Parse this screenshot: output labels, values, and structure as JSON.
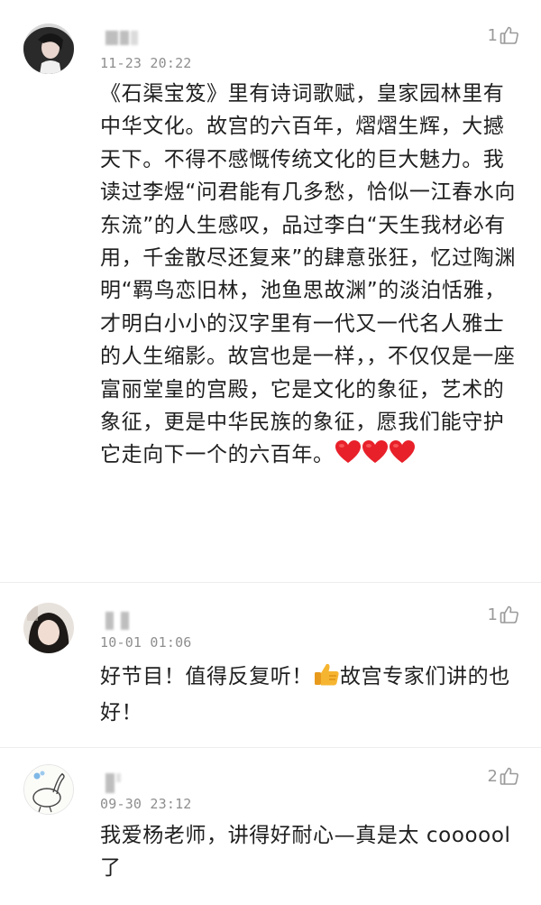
{
  "comments": [
    {
      "timestamp": "11-23 20:22",
      "likes": "1",
      "text_before": "《石渠宝笈》里有诗词歌赋，皇家园林里有中华文化。故宫的六百年，熠熠生辉，大撼天下。不得不感慨传统文化的巨大魅力。我读过李煜“问君能有几多愁，恰似一江春水向东流”的人生感叹，品过李白“天生我材必有用，千金散尽还复来”的肆意张狂，忆过陶渊明“羁鸟恋旧林，池鱼思故渊”的淡泊恬雅，才明白小小的汉字里有一代又一代名人雅士的人生缩影。故宫也是一样，，不仅仅是一座富丽堂皇的宫殿，它是文化的象征，艺术的象征，更是中华民族的象征，愿我们能守护它走向下一个的六百年。",
      "emoji": [
        "red-heart-icon",
        "red-heart-icon",
        "red-heart-icon"
      ]
    },
    {
      "timestamp": "10-01 01:06",
      "likes": "1",
      "text_before": "好节目！值得反复听！",
      "emoji": [
        "thumbs-up-icon"
      ],
      "text_after": "故宫专家们讲的也好！"
    },
    {
      "timestamp": "09-30 23:12",
      "likes": "2",
      "text_before": "我爱杨老师，讲得好耐心—真是太 coooool 了"
    }
  ],
  "colors": {
    "text": "#1f1f1f",
    "meta": "#8e8e8e",
    "like": "#9a9a9a",
    "heart": "#e8202a",
    "thumb": "#f6b531"
  }
}
